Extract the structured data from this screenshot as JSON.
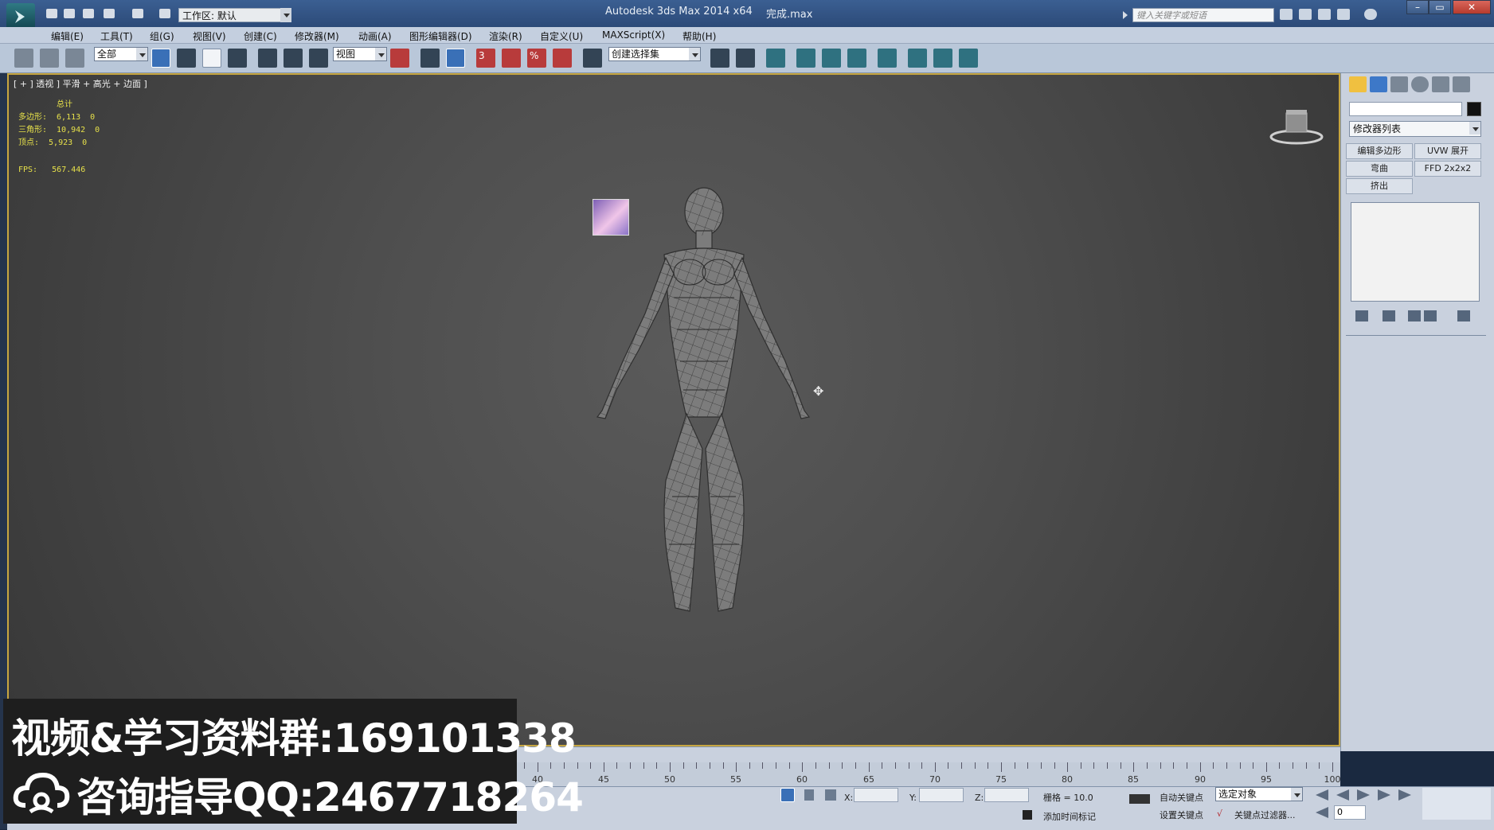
{
  "titlebar": {
    "workspace_label": "工作区: 默认",
    "app_title": "Autodesk 3ds Max  2014 x64",
    "file_name": "完成.max",
    "search_placeholder": "键入关键字或短语"
  },
  "menu": [
    "编辑(E)",
    "工具(T)",
    "组(G)",
    "视图(V)",
    "创建(C)",
    "修改器(M)",
    "动画(A)",
    "图形编辑器(D)",
    "渲染(R)",
    "自定义(U)",
    "MAXScript(X)",
    "帮助(H)"
  ],
  "toolbar": {
    "selection_filter": "全部",
    "reference_coord": "视图",
    "named_selection_set": "创建选择集",
    "snap_labels": [
      "3",
      "%"
    ]
  },
  "viewport": {
    "label": "[ + ] 透视 ] 平滑 + 高光 + 边面 ]",
    "stats_title": "总计",
    "stats": [
      {
        "label": "多边形:",
        "value": "6,113",
        "selected": "0"
      },
      {
        "label": "三角形:",
        "value": "10,942",
        "selected": "0"
      },
      {
        "label": "顶点:",
        "value": "5,923",
        "selected": "0"
      }
    ],
    "fps_label": "FPS:",
    "fps_value": "567.446"
  },
  "command_panel": {
    "modifier_list": "修改器列表",
    "modifier_buttons": [
      "编辑多边形",
      "UVW 展开",
      "弯曲",
      "FFD 2x2x2",
      "挤出"
    ]
  },
  "timeline": {
    "ticks": [
      40,
      45,
      50,
      55,
      60,
      65,
      70,
      75,
      80,
      85,
      90,
      95,
      100
    ]
  },
  "status": {
    "x_label": "X:",
    "y_label": "Y:",
    "z_label": "Z:",
    "grid": "栅格 = 10.0",
    "add_time_tag": "添加时间标记",
    "auto_key": "自动关键点",
    "set_key": "设置关键点",
    "selected_object": "选定对象",
    "key_filters": "关键点过滤器...",
    "current_frame": "0"
  },
  "watermark": {
    "line1": "视频&学习资料群:169101338",
    "line2": "咨询指导QQ:2467718264"
  }
}
